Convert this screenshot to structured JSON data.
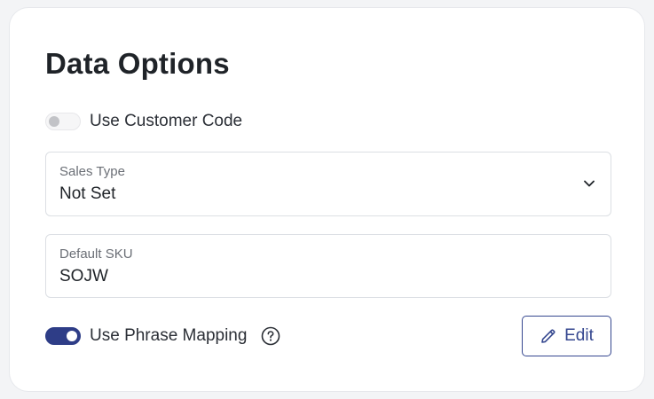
{
  "panel": {
    "title": "Data Options"
  },
  "customer_code": {
    "label": "Use Customer Code",
    "enabled": false
  },
  "sales_type": {
    "label": "Sales Type",
    "value": "Not Set"
  },
  "default_sku": {
    "label": "Default SKU",
    "value": "SOJW"
  },
  "phrase_mapping": {
    "label": "Use Phrase Mapping",
    "enabled": true,
    "help_icon": "question-circle-icon"
  },
  "edit_button": {
    "label": "Edit",
    "icon": "pencil-icon"
  },
  "colors": {
    "accent": "#2e3d87",
    "border": "#dcdfe4",
    "text": "#1f2328"
  }
}
